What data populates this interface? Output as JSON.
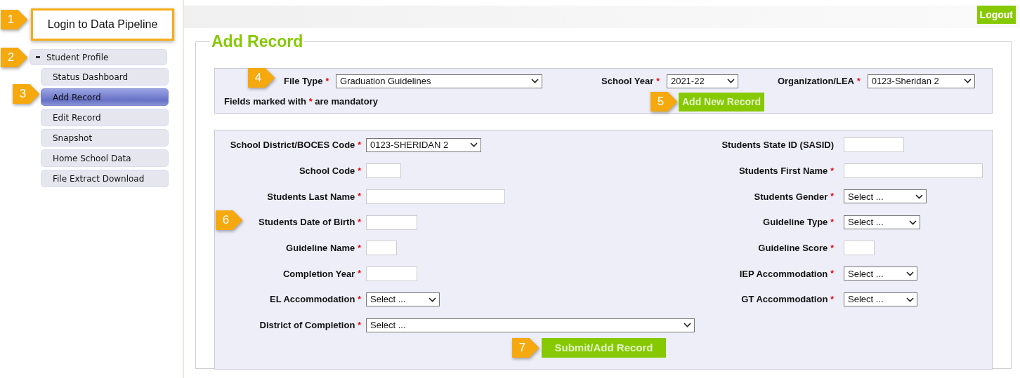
{
  "login": {
    "text": "Login to Data Pipeline",
    "callout": "1"
  },
  "menu": {
    "title": "Student Profile",
    "expanded": true,
    "callout": "2",
    "items": [
      {
        "label": "Status Dashboard",
        "selected": false
      },
      {
        "label": "Add Record",
        "selected": true,
        "callout": "3"
      },
      {
        "label": "Edit Record",
        "selected": false
      },
      {
        "label": "Snapshot",
        "selected": false
      },
      {
        "label": "Home School Data",
        "selected": false
      },
      {
        "label": "File Extract Download",
        "selected": false
      }
    ]
  },
  "logout": "Logout",
  "page_title": "Add Record",
  "filters": [
    {
      "label": "File Type",
      "mark": "*",
      "value": "Graduation Guidelines",
      "callout": "4"
    },
    {
      "label": "School Year",
      "mark": "*",
      "value": "2021-22"
    },
    {
      "label": "Organization/LEA",
      "mark": "*",
      "value": "0123-Sheridan 2"
    }
  ],
  "note": {
    "before": "Fields marked with",
    "mark": "*",
    "after": "are mandatory"
  },
  "add_button": {
    "label": "Add New Record",
    "callout": "5"
  },
  "rows": [
    {
      "left": {
        "label": "School District/BOCES Code",
        "mark": "*",
        "kind": "select",
        "value": "0123-SHERIDAN 2"
      },
      "right": {
        "label": "Students State ID (SASID)",
        "kind": "text"
      }
    },
    {
      "left": {
        "label": "School Code",
        "mark": "*",
        "kind": "text"
      },
      "right": {
        "label": "Students First Name",
        "mark": "*",
        "kind": "text"
      }
    },
    {
      "left": {
        "label": "Students Last Name",
        "mark": "*",
        "kind": "text"
      },
      "right": {
        "label": "Students Gender",
        "mark": "*",
        "kind": "select",
        "value": "Select ..."
      }
    },
    {
      "left": {
        "label": "Students Date of Birth",
        "mark": "*",
        "kind": "text",
        "callout": "6"
      },
      "right": {
        "label": "Guideline Type",
        "mark": "*",
        "kind": "select",
        "value": "Select ..."
      }
    },
    {
      "left": {
        "label": "Guideline Name",
        "mark": "*",
        "kind": "text"
      },
      "right": {
        "label": "Guideline Score",
        "mark": "*",
        "kind": "text"
      }
    },
    {
      "left": {
        "label": "Completion Year",
        "mark": "*",
        "kind": "text"
      },
      "right": {
        "label": "IEP Accommodation",
        "mark": "*",
        "kind": "select",
        "value": "Select ..."
      }
    },
    {
      "left": {
        "label": "EL Accommodation",
        "mark": "*",
        "kind": "select",
        "value": "Select ..."
      },
      "right": {
        "label": "GT Accommodation",
        "mark": "*",
        "kind": "select",
        "value": "Select ..."
      }
    },
    {
      "left": {
        "label": "District of Completion",
        "mark": "*",
        "kind": "select",
        "value": "Select ..."
      }
    }
  ],
  "submit": {
    "label": "Submit/Add Record",
    "callout": "7"
  }
}
